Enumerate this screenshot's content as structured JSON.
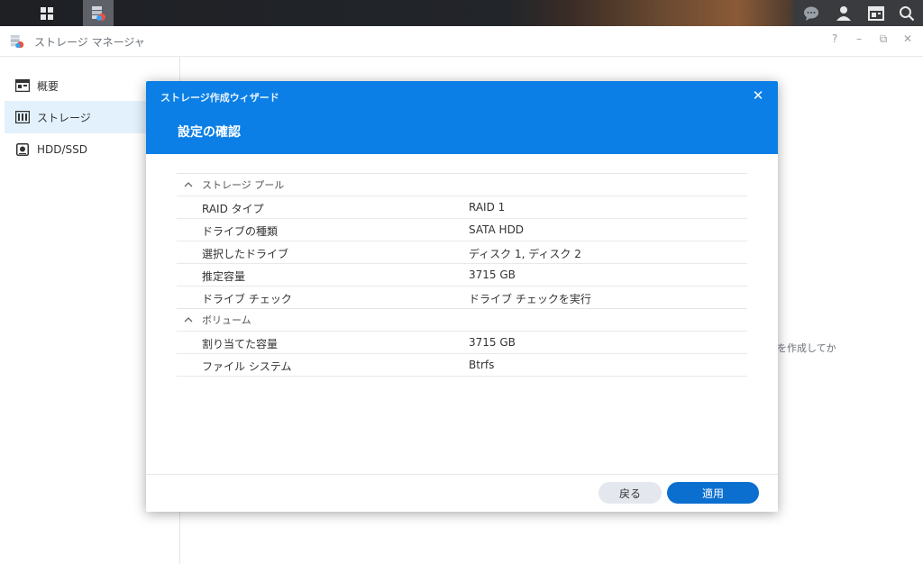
{
  "app": {
    "title": "ストレージ マネージャ",
    "window_controls": [
      "?",
      "–",
      "⧉",
      "✕"
    ]
  },
  "sidebar": {
    "items": [
      {
        "label": "概要",
        "icon": "overview-icon"
      },
      {
        "label": "ストレージ",
        "icon": "storage-icon",
        "active": true
      },
      {
        "label": "HDD/SSD",
        "icon": "disk-icon"
      }
    ]
  },
  "main": {
    "background_text_fragment": "を作成してか"
  },
  "wizard": {
    "title": "ストレージ作成ウィザード",
    "step_title": "設定の確認",
    "sections": [
      {
        "title": "ストレージ プール",
        "rows": [
          {
            "key": "RAID タイプ",
            "value": "RAID 1"
          },
          {
            "key": "ドライブの種類",
            "value": "SATA HDD"
          },
          {
            "key": "選択したドライブ",
            "value": "ディスク 1, ディスク 2"
          },
          {
            "key": "推定容量",
            "value": "3715 GB"
          },
          {
            "key": "ドライブ チェック",
            "value": "ドライブ チェックを実行"
          }
        ]
      },
      {
        "title": "ボリューム",
        "rows": [
          {
            "key": "割り当てた容量",
            "value": "3715 GB"
          },
          {
            "key": "ファイル システム",
            "value": "Btrfs"
          }
        ]
      }
    ],
    "buttons": {
      "back": "戻る",
      "apply": "適用"
    },
    "colors": {
      "header": "#0b7fe6",
      "apply_button": "#0b6fd0"
    }
  }
}
